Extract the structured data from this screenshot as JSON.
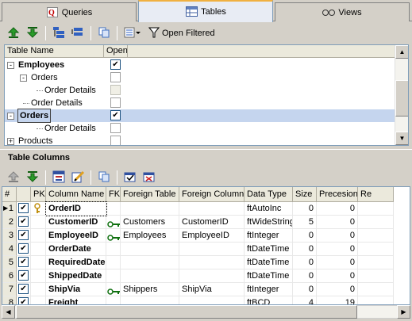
{
  "tabs": [
    {
      "label": "Queries",
      "icon": "queries-icon"
    },
    {
      "label": "Tables",
      "icon": "tables-icon"
    },
    {
      "label": "Views",
      "icon": "views-icon"
    }
  ],
  "active_tab": "Tables",
  "toolbar": {
    "open_filtered_label": "Open Filtered"
  },
  "tables_panel": {
    "col_table_name": "Table Name",
    "col_open": "Open",
    "rows": [
      {
        "label": "Employees",
        "open": true
      },
      {
        "label": "Orders",
        "open": false
      },
      {
        "label": "Order Details",
        "open": false
      },
      {
        "label": "Order Details",
        "open": false
      },
      {
        "label": "Orders",
        "open": true
      },
      {
        "label": "Order Details",
        "open": false
      },
      {
        "label": "Products",
        "open": false
      }
    ]
  },
  "columns_panel": {
    "title": "Table Columns",
    "headers": [
      "#",
      "",
      "PK",
      "Column Name",
      "FK",
      "Foreign Table",
      "Foreign Column",
      "Data Type",
      "Size",
      "Precesion",
      "Re"
    ],
    "rows": [
      {
        "n": "1",
        "name": "OrderID",
        "pk": true,
        "fk": false,
        "ftable": "",
        "fcol": "",
        "type": "ftAutoInc",
        "size": "0",
        "prec": "0"
      },
      {
        "n": "2",
        "name": "CustomerID",
        "pk": false,
        "fk": true,
        "ftable": "Customers",
        "fcol": "CustomerID",
        "type": "ftWideString",
        "size": "5",
        "prec": "0"
      },
      {
        "n": "3",
        "name": "EmployeeID",
        "pk": false,
        "fk": true,
        "ftable": "Employees",
        "fcol": "EmployeeID",
        "type": "ftInteger",
        "size": "0",
        "prec": "0"
      },
      {
        "n": "4",
        "name": "OrderDate",
        "pk": false,
        "fk": false,
        "ftable": "",
        "fcol": "",
        "type": "ftDateTime",
        "size": "0",
        "prec": "0"
      },
      {
        "n": "5",
        "name": "RequiredDate",
        "pk": false,
        "fk": false,
        "ftable": "",
        "fcol": "",
        "type": "ftDateTime",
        "size": "0",
        "prec": "0"
      },
      {
        "n": "6",
        "name": "ShippedDate",
        "pk": false,
        "fk": false,
        "ftable": "",
        "fcol": "",
        "type": "ftDateTime",
        "size": "0",
        "prec": "0"
      },
      {
        "n": "7",
        "name": "ShipVia",
        "pk": false,
        "fk": true,
        "ftable": "Shippers",
        "fcol": "ShipVia",
        "type": "ftInteger",
        "size": "0",
        "prec": "0"
      },
      {
        "n": "8",
        "name": "Freight",
        "pk": false,
        "fk": false,
        "ftable": "",
        "fcol": "",
        "type": "ftBCD",
        "size": "4",
        "prec": "19"
      }
    ]
  },
  "colors": {
    "accent": "#f0b040",
    "selection": "#c5d5ee",
    "tree_line": "#808080"
  }
}
